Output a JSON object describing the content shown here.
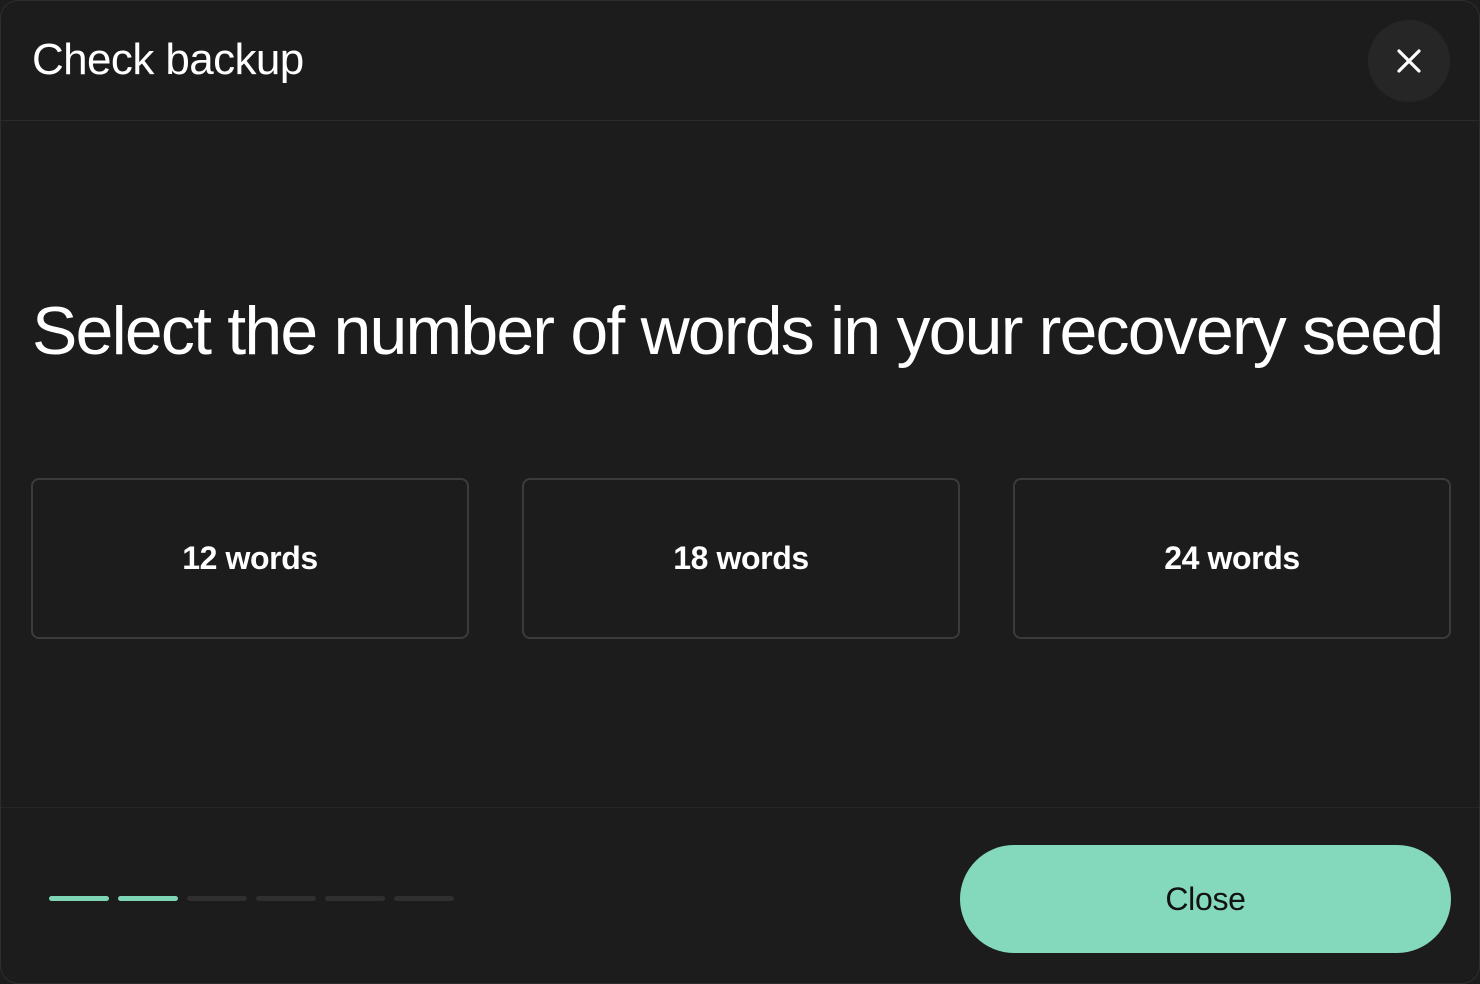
{
  "dialog": {
    "title": "Check backup",
    "close_icon": "close-icon"
  },
  "main": {
    "headline": "Select the number of words in your recovery seed",
    "options": [
      {
        "label": "12 words"
      },
      {
        "label": "18 words"
      },
      {
        "label": "24 words"
      }
    ]
  },
  "footer": {
    "progress": {
      "completed_steps": 2,
      "total_steps": 6
    },
    "close_label": "Close"
  },
  "colors": {
    "background": "#1c1c1c",
    "accent": "#84d8bb",
    "progress_active": "#7fd6b6",
    "progress_inactive": "#2f2f2f",
    "option_border": "#3b3b3b"
  }
}
